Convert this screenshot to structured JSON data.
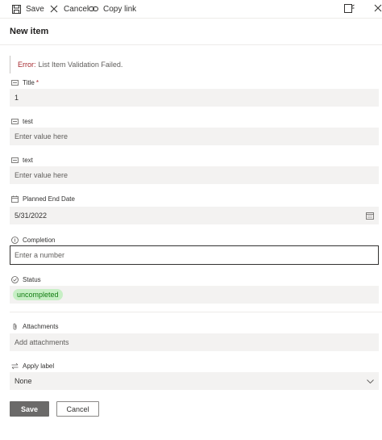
{
  "toolbar": {
    "save_label": "Save",
    "cancel_label": "Cancel",
    "copy_link_label": "Copy link"
  },
  "form": {
    "title": "New item",
    "error": {
      "prefix": "Error:",
      "message": "List Item Validation Failed."
    },
    "fields": {
      "title": {
        "label": "Title",
        "required_mark": "*",
        "value": "1"
      },
      "test": {
        "label": "test",
        "placeholder": "Enter value here"
      },
      "text": {
        "label": "text",
        "placeholder": "Enter value here"
      },
      "planned_end_date": {
        "label": "Planned End Date",
        "value": "5/31/2022"
      },
      "completion": {
        "label": "Completion",
        "placeholder": "Enter a number"
      },
      "status": {
        "label": "Status",
        "value": "uncompleted"
      },
      "attachments": {
        "label": "Attachments",
        "placeholder": "Add attachments"
      },
      "apply_label": {
        "label": "Apply label",
        "value": "None"
      }
    },
    "buttons": {
      "save_label": "Save",
      "cancel_label": "Cancel"
    }
  },
  "colors": {
    "error_red": "#a4262c",
    "status_pill_bg": "#c7efc5",
    "status_pill_text": "#107c10",
    "save_button_bg": "#6b6a69"
  }
}
